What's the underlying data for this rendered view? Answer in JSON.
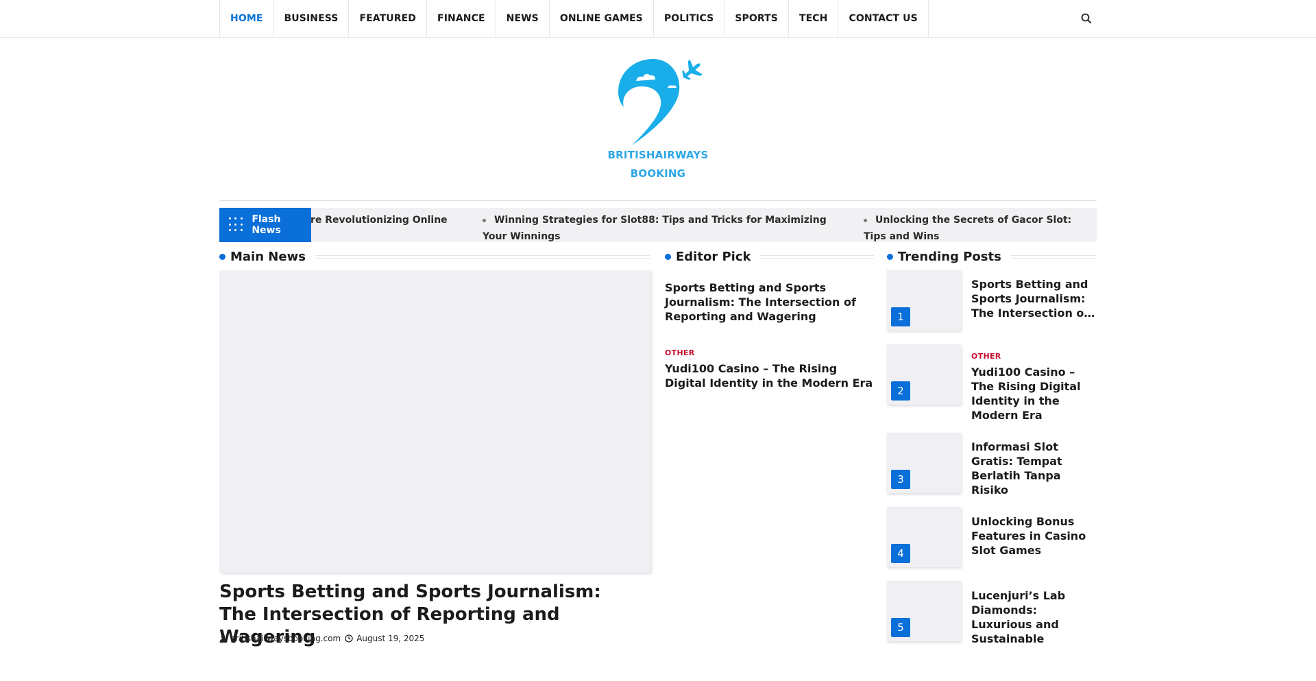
{
  "nav": {
    "items": [
      "HOME",
      "BUSINESS",
      "FEATURED",
      "FINANCE",
      "NEWS",
      "ONLINE GAMES",
      "POLITICS",
      "SPORTS",
      "TECH",
      "CONTACT US"
    ],
    "active_color": "#0a74d8"
  },
  "logo": {
    "line1": "BRITISHAIRWAYS",
    "line2": "BOOKING",
    "color": "#2fa7e6"
  },
  "flash_news": {
    "label": "Flash News",
    "items": [
      "re Revolutionizing Online",
      "Winning Strategies for Slot88: Tips and Tricks for Maximizing Your Winnings",
      "Unlocking the Secrets of Gacor Slot: Tips and Wins"
    ]
  },
  "main_news": {
    "heading": "Main News",
    "title": "Sports Betting and Sports Journalism: The Intersection of Reporting and Wagering",
    "author": "britishairwaysbooking.com",
    "date": "August 19, 2025"
  },
  "editor_pick": {
    "heading": "Editor Pick",
    "items": [
      {
        "category": "",
        "title": "Sports Betting and Sports Journalism: The Intersection of Reporting and Wagering"
      },
      {
        "category": "OTHER",
        "title": "Yudi100 Casino – The Rising Digital Identity in the Modern Era"
      }
    ]
  },
  "trending": {
    "heading": "Trending Posts",
    "items": [
      {
        "rank": "1",
        "category": "",
        "title": "Sports Betting and Sports Journalism: The Intersection of Reporting and Wagering"
      },
      {
        "rank": "2",
        "category": "OTHER",
        "title": "Yudi100 Casino – The Rising Digital Identity in the Modern Era"
      },
      {
        "rank": "3",
        "category": "",
        "title": "Informasi Slot Gratis: Tempat Berlatih Tanpa Risiko"
      },
      {
        "rank": "4",
        "category": "",
        "title": "Unlocking Bonus Features in Casino Slot Games"
      },
      {
        "rank": "5",
        "category": "",
        "title": "Lucenjuri’s Lab Diamonds: Luxurious and Sustainable"
      }
    ]
  },
  "colors": {
    "accent": "#0a6fd8",
    "category": "#c8102e"
  }
}
